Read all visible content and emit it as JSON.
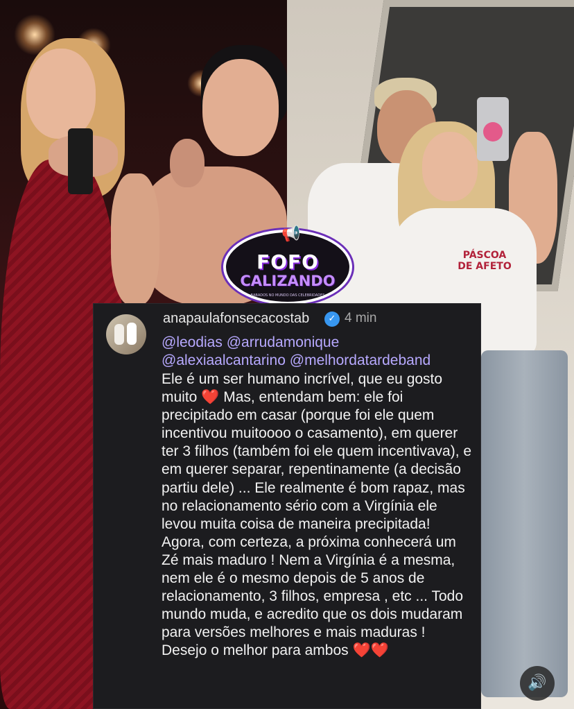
{
  "logo": {
    "line1": "FOFO",
    "line2": "CALIZANDO",
    "tagline": "BABADOS NO MUNDO DAS CELEBRIDADES"
  },
  "comment": {
    "username": "anapaulafonsecacostab",
    "time": "4 min",
    "mentions_line1": "@leodias @arrudamonique",
    "mentions_line2": "@alexiaalcantarino @melhordatardeband",
    "body_part1": "Ele é um ser humano incrível, que eu gosto muito",
    "heart": "❤️",
    "body_part2": "Mas, entendam bem: ele foi precipitado em casar (porque foi ele quem incentivou muitoooo o casamento), em querer ter 3 filhos (também foi ele quem incentivava), e em querer separar, repentinamente (a decisão partiu dele) ... Ele realmente é bom rapaz, mas no relacionamento sério com a Virgínia ele levou muita coisa de maneira precipitada! Agora, com certeza, a próxima conhecerá um Zé mais maduro ! Nem a Virgínia é a mesma, nem ele é o mesmo depois de 5 anos de relacionamento, 3 filhos, empresa , etc ... Todo mundo muda, e acredito que os dois mudaram para versões melhores e mais maduras ! Desejo o melhor para ambos",
    "hearts_end": "❤️❤️"
  },
  "shirt_print": {
    "line1": "PÁSCOA",
    "line2": "DE AFETO"
  },
  "icons": {
    "verified": "verified-badge-icon",
    "sound": "speaker-icon",
    "megaphone": "megaphone-icon"
  },
  "colors": {
    "card_bg": "#1c1c1f",
    "mention": "#b7a9ff",
    "verified": "#3897f0",
    "logo_purple": "#8a2be2"
  }
}
